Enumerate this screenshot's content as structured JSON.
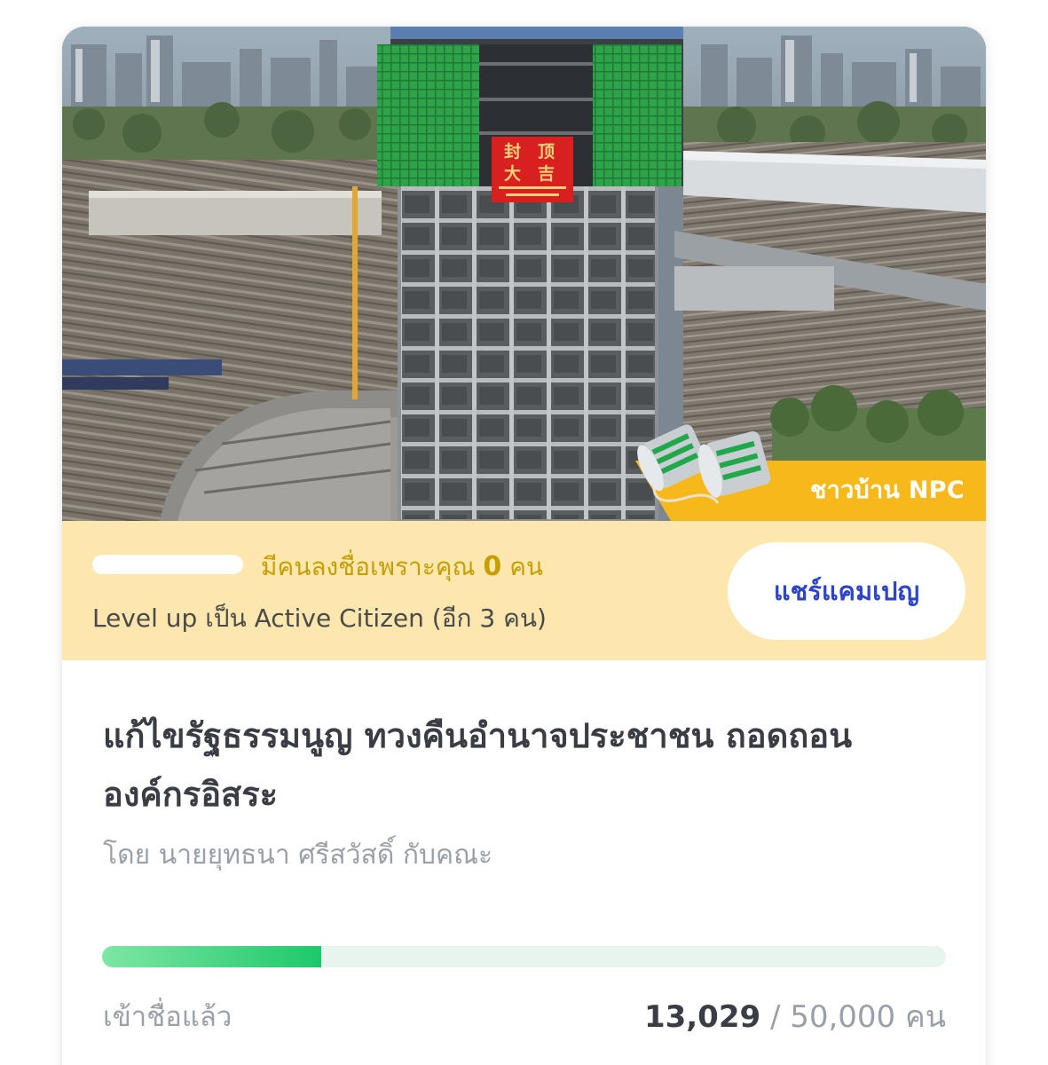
{
  "hero": {
    "banner_text": "封 顶 大 吉",
    "badge_label": "ชาวบ้าน NPC"
  },
  "referral": {
    "prefix": "มีคนลงชื่อเพราะคุณ",
    "count": "0",
    "suffix": "คน",
    "level_up_text": "Level up เป็น Active Citizen (อีก 3 คน)",
    "share_label": "แชร์แคมเปญ"
  },
  "campaign": {
    "title": "แก้ไขรัฐธรรมนูญ ทวงคืนอำนาจประชาชน ถอดถอนองค์กรอิสระ",
    "byline": "โดย นายยุทธนา ศรีสวัสดิ์ กับคณะ"
  },
  "progress": {
    "label": "เข้าชื่อแล้ว",
    "current": "13,029",
    "separator": " / ",
    "goal": "50,000",
    "unit": "คน",
    "fraction": 0.26
  },
  "colors": {
    "badge_gold": "#f6b81a",
    "referral_bg": "#fde7ae",
    "share_text": "#2c45c9",
    "progress_fill": "#1fc86a",
    "progress_track": "#e7f5ee"
  }
}
